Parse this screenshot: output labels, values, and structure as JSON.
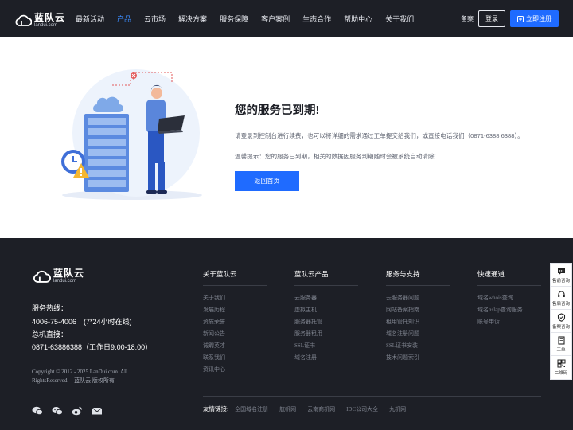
{
  "brand": {
    "name_cn": "蓝队云",
    "name_en": "landui.com"
  },
  "nav": {
    "items": [
      {
        "label": "最新活动",
        "active": false
      },
      {
        "label": "产品",
        "active": true
      },
      {
        "label": "云市场",
        "active": false
      },
      {
        "label": "解决方案",
        "active": false
      },
      {
        "label": "服务保障",
        "active": false
      },
      {
        "label": "客户案例",
        "active": false
      },
      {
        "label": "生态合作",
        "active": false
      },
      {
        "label": "帮助中心",
        "active": false
      },
      {
        "label": "关于我们",
        "active": false
      }
    ],
    "beian": "备案",
    "login": "登录",
    "register": "立即注册"
  },
  "main": {
    "title": "您的服务已到期!",
    "desc": "请登录到控制台进行续费，也可以将详细的需求通过工单提交给我们，或直接电话我们（0871-6388 6388）。",
    "tip": "温馨提示：您的服务已到期，相关的数据因服务到期随时会被系统自动清除!",
    "button": "返回首页"
  },
  "footer": {
    "hotline_label": "服务热线：",
    "hotline": "4006-75-4006　(7*24小时在线)",
    "direct_label": "总机直接：",
    "direct": "0871-63886388（工作日9:00-18:00）",
    "copyright": "Copyright © 2012 - 2025 LanDui.com. All RightsReserved.　蓝队云 版权所有",
    "columns": [
      {
        "title": "关于蓝队云",
        "links": [
          "关于我们",
          "发展历程",
          "资质荣誉",
          "新闻公告",
          "诚聘英才",
          "联系我们",
          "资讯中心"
        ]
      },
      {
        "title": "蓝队云产品",
        "links": [
          "云服务器",
          "虚拟主机",
          "服务器托管",
          "服务器租用",
          "SSL证书",
          "域名注册"
        ]
      },
      {
        "title": "服务与支持",
        "links": [
          "云服务器问题",
          "网站备案指南",
          "租用管托知识",
          "域名注册问题",
          "SSL证书安装",
          "技术问题索引"
        ]
      },
      {
        "title": "快速通道",
        "links": [
          "域名whois查询",
          "域名nslap查询服务",
          "账号申诉"
        ]
      }
    ],
    "friend_label": "友情链接:",
    "friend_links": [
      "全国域名注册",
      "航帆网",
      "云南商机网",
      "IDC公司大全",
      "九机网"
    ],
    "socials": [
      "chat-icon",
      "wechat-icon",
      "weibo-icon",
      "mail-icon"
    ]
  },
  "side": [
    {
      "label": "售前咨询",
      "icon": "chat-bubble-icon"
    },
    {
      "label": "售后咨询",
      "icon": "headset-icon"
    },
    {
      "label": "备案咨询",
      "icon": "shield-icon"
    },
    {
      "label": "工单",
      "icon": "ticket-icon"
    },
    {
      "label": "二维码",
      "icon": "qrcode-icon"
    }
  ],
  "colors": {
    "header_bg": "#1d1f26",
    "accent": "#1f6bff",
    "nav_active": "#3b8cff"
  }
}
